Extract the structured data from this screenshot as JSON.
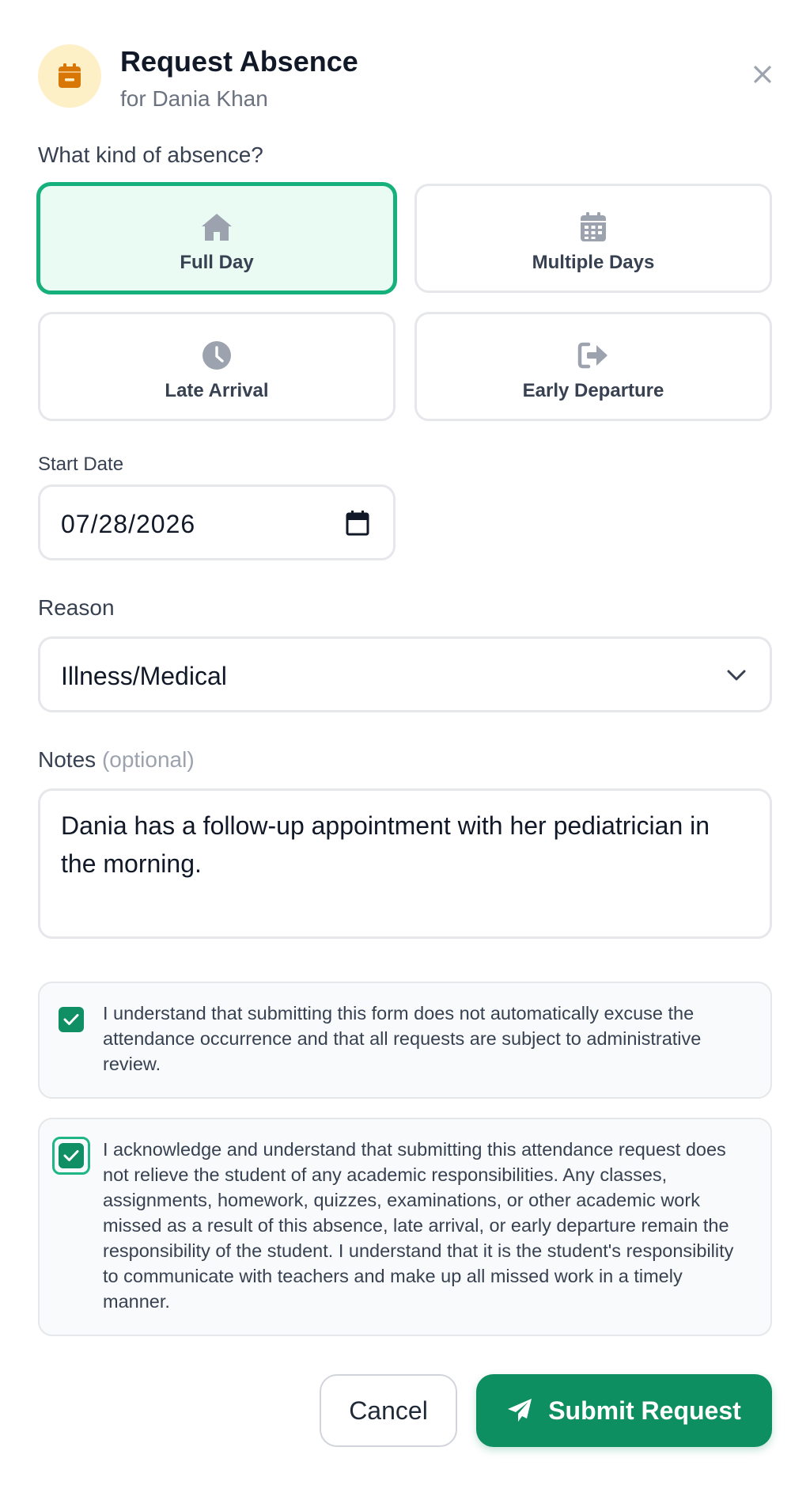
{
  "header": {
    "title": "Request Absence",
    "subtitle": "for Dania Khan",
    "icon": "calendar-minus-icon",
    "icon_color": "#d97706",
    "icon_bg": "#fdefc6"
  },
  "absence_type": {
    "label": "What kind of absence?",
    "selected": "Full Day",
    "options": [
      {
        "label": "Full Day",
        "icon": "home-icon",
        "selected": true
      },
      {
        "label": "Multiple Days",
        "icon": "calendar-icon",
        "selected": false
      },
      {
        "label": "Late Arrival",
        "icon": "clock-icon",
        "selected": false
      },
      {
        "label": "Early Departure",
        "icon": "sign-out-icon",
        "selected": false
      }
    ]
  },
  "start_date": {
    "label": "Start Date",
    "value": "07/28/2026"
  },
  "reason": {
    "label": "Reason",
    "value": "Illness/Medical"
  },
  "notes": {
    "label": "Notes",
    "optional": "(optional)",
    "value": "Dania has a follow-up appointment with her pediatrician in the morning."
  },
  "acknowledgements": [
    {
      "checked": true,
      "text": "I understand that submitting this form does not automatically excuse the attendance occurrence and that all requests are subject to administrative review."
    },
    {
      "checked": true,
      "focused": true,
      "text": "I acknowledge and understand that submitting this attendance request does not relieve the student of any academic responsibilities. Any classes, assignments, homework, quizzes, examinations, or other academic work missed as a result of this absence, late arrival, or early departure remain the responsibility of the student. I understand that it is the student's responsibility to communicate with teachers and make up all missed work in a timely manner."
    }
  ],
  "footer": {
    "cancel_label": "Cancel",
    "submit_label": "Submit Request",
    "submit_icon": "paper-plane-icon"
  },
  "colors": {
    "accent": "#0e8f62",
    "selected_border": "#16b07c",
    "selected_bg": "#e9fbf2"
  }
}
